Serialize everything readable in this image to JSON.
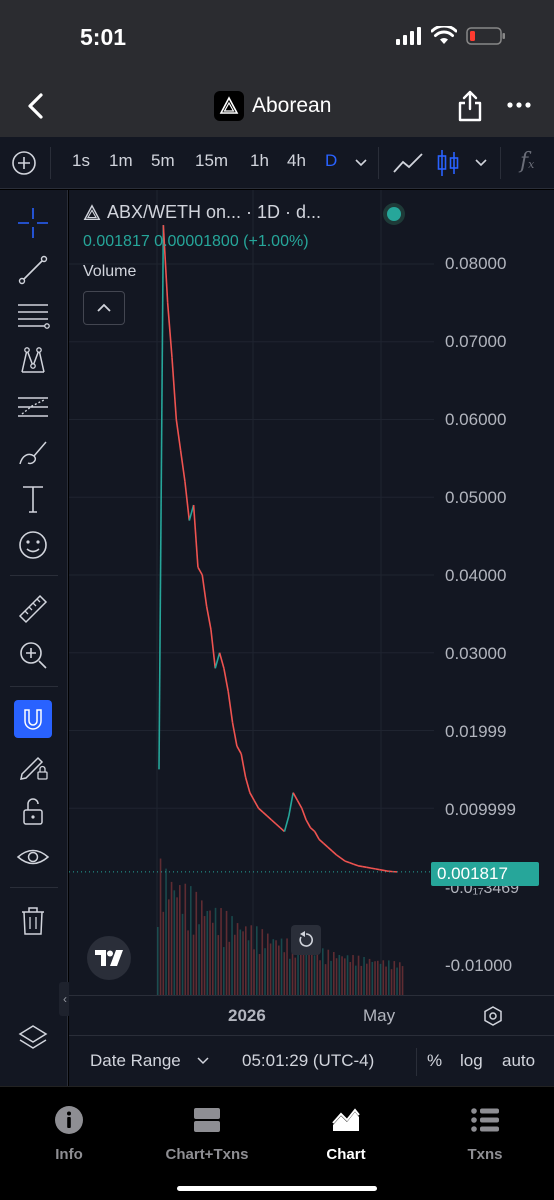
{
  "status": {
    "time": "5:01"
  },
  "header": {
    "title": "Aborean"
  },
  "toolbar": {
    "intervals": [
      "1s",
      "1m",
      "5m",
      "15m",
      "1h",
      "4h",
      "D"
    ],
    "active_interval": "D",
    "colors": {
      "active": "#2962ff",
      "text": "#d1d4dc"
    }
  },
  "chart": {
    "symbol_line": "ABX/WETH on... · 1D · d...",
    "legend_values": "0.001817  0.00001800 (+1.00%)",
    "volume_label": "Volume",
    "last_price_label": "0.001817",
    "y_ticks": [
      "0.08000",
      "0.07000",
      "0.06000",
      "0.05000",
      "0.04000",
      "0.03000",
      "0.01999",
      "0.009999",
      "-0.01000"
    ],
    "partial_tick": "-0.0₁₇3469",
    "x_ticks": [
      "2026",
      "May"
    ],
    "colors": {
      "up": "#26a69a",
      "down": "#ef5350",
      "bg": "#131722",
      "grid": "#1f2430"
    }
  },
  "chart_data": {
    "type": "line",
    "title": "ABX/WETH on... · 1D · d...",
    "xlabel": "",
    "ylabel": "",
    "x_ticks": [
      "2026",
      "May"
    ],
    "y_ticks": [
      0.08,
      0.07,
      0.06,
      0.05,
      0.04,
      0.03,
      0.01999,
      0.009999,
      -0.01
    ],
    "last_value": 0.001817,
    "series": [
      {
        "values": [
          0.015,
          0.085,
          0.075,
          0.068,
          0.06,
          0.056,
          0.052,
          0.047,
          0.049,
          0.041,
          0.04,
          0.036,
          0.033,
          0.028,
          0.03,
          0.028,
          0.025,
          0.021,
          0.018,
          0.017,
          0.014,
          0.012,
          0.011,
          0.01,
          0.0095,
          0.009,
          0.0085,
          0.008,
          0.0075,
          0.007,
          0.009,
          0.012,
          0.011,
          0.01,
          0.0085,
          0.0075,
          0.007,
          0.006,
          0.0055,
          0.005,
          0.0045,
          0.004,
          0.0036,
          0.0032,
          0.003,
          0.0028,
          0.0026,
          0.0025,
          0.0024,
          0.0023,
          0.0022,
          0.0021,
          0.002,
          0.0019,
          0.00185,
          0.001817
        ]
      }
    ]
  },
  "bottom": {
    "date_range": "Date Range",
    "clock": "05:01:29 (UTC-4)",
    "pct": "%",
    "log": "log",
    "auto": "auto"
  },
  "tabs": [
    {
      "label": "Info",
      "icon": "info-icon"
    },
    {
      "label": "Chart+Txns",
      "icon": "split-view-icon"
    },
    {
      "label": "Chart",
      "icon": "chart-icon",
      "active": true
    },
    {
      "label": "Txns",
      "icon": "list-icon"
    }
  ]
}
